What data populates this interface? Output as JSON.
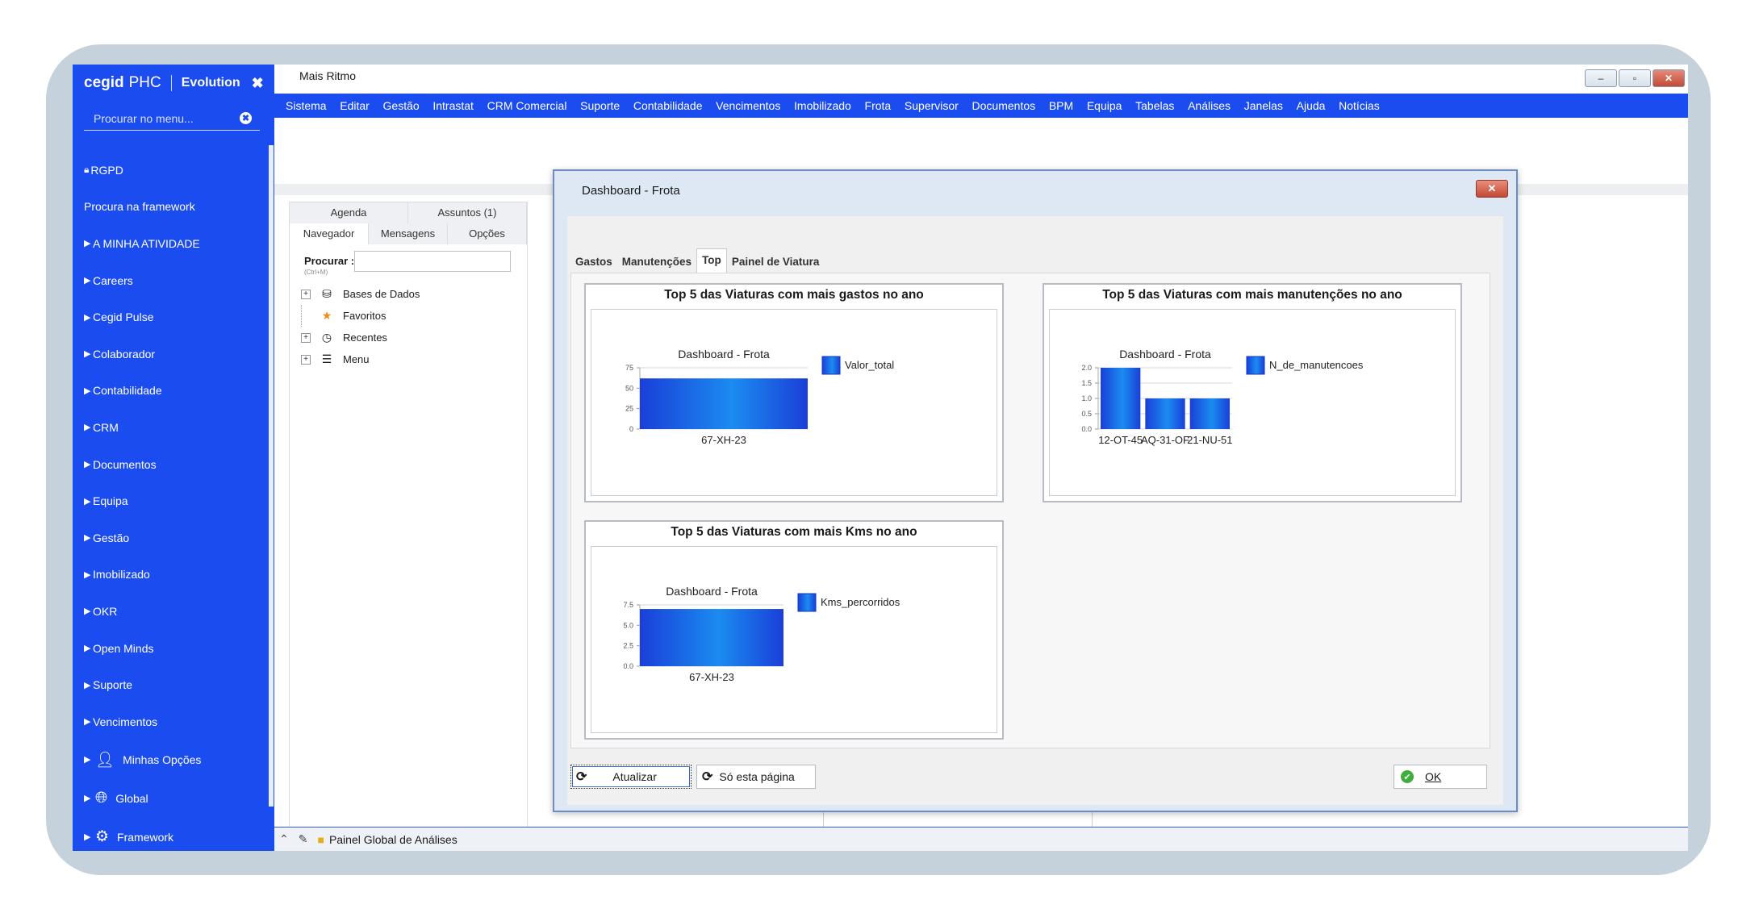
{
  "sidebar": {
    "brand": {
      "name": "cegid",
      "product": "PHC",
      "edition": "Evolution",
      "close_icon": "✖"
    },
    "search": {
      "placeholder": "Procurar no menu...",
      "clear_icon": "✖"
    },
    "items": [
      {
        "label": "RGPD",
        "icon": "lock-icon"
      },
      {
        "label": "Procura na framework"
      },
      {
        "label": "A MINHA ATIVIDADE"
      },
      {
        "label": "Careers"
      },
      {
        "label": "Cegid Pulse"
      },
      {
        "label": "Colaborador"
      },
      {
        "label": "Contabilidade"
      },
      {
        "label": "CRM"
      },
      {
        "label": "Documentos"
      },
      {
        "label": "Equipa"
      },
      {
        "label": "Gestão"
      },
      {
        "label": "Imobilizado"
      },
      {
        "label": "OKR"
      },
      {
        "label": "Open Minds"
      },
      {
        "label": "Suporte"
      },
      {
        "label": "Vencimentos"
      },
      {
        "label": "Minhas Opções",
        "icon": "user-icon"
      },
      {
        "label": "Global",
        "icon": "globe-icon"
      },
      {
        "label": "Framework",
        "icon": "gears-icon"
      }
    ]
  },
  "window": {
    "title": "Mais Ritmo",
    "controls": {
      "minimize": "–",
      "maximize": "▫",
      "close": "✕"
    },
    "menu": [
      "Sistema",
      "Editar",
      "Gestão",
      "Intrastat",
      "CRM Comercial",
      "Suporte",
      "Contabilidade",
      "Vencimentos",
      "Imobilizado",
      "Frota",
      "Supervisor",
      "Documentos",
      "BPM",
      "Equipa",
      "Tabelas",
      "Análises",
      "Janelas",
      "Ajuda",
      "Notícias"
    ]
  },
  "navigator": {
    "top_tabs": [
      "Agenda",
      "Assuntos (1)"
    ],
    "tabs": [
      "Navegador",
      "Mensagens",
      "Opções"
    ],
    "search_label": "Procurar :",
    "search_hint": "(Ctrl+M)",
    "tree": [
      {
        "label": "Bases de Dados",
        "icon": "database-icon",
        "expandable": true
      },
      {
        "label": "Favoritos",
        "icon": "star-icon",
        "expandable": false
      },
      {
        "label": "Recentes",
        "icon": "clock-icon",
        "expandable": true
      },
      {
        "label": "Menu",
        "icon": "menu-icon",
        "expandable": true
      }
    ]
  },
  "statusbar": {
    "label": "Painel Global de Análises"
  },
  "dialog": {
    "title": "Dashboard - Frota",
    "close": "✕",
    "tabs": [
      "Gastos",
      "Manutenções",
      "Top",
      "Painel de Viatura"
    ],
    "active_tab": "Top",
    "buttons": {
      "refresh": "Atualizar",
      "this_page": "Só esta página",
      "ok": "OK"
    }
  },
  "chart_data": [
    {
      "type": "bar",
      "panel_title": "Top 5 das Viaturas com mais gastos no ano",
      "title": "Dashboard - Frota",
      "categories": [
        "67-XH-23"
      ],
      "series": [
        {
          "name": "Valor_total",
          "values": [
            62
          ]
        }
      ],
      "yticks": [
        "75",
        "50",
        "25",
        "0"
      ],
      "ylim": [
        0,
        75
      ],
      "legend": "right",
      "color": "#1650e6"
    },
    {
      "type": "bar",
      "panel_title": "Top 5 das Viaturas com mais manutenções no ano",
      "title": "Dashboard - Frota",
      "categories": [
        "12-OT-45",
        "AQ-31-OF",
        "21-NU-51"
      ],
      "series": [
        {
          "name": "N_de_manutencoes",
          "values": [
            2,
            1,
            1
          ]
        }
      ],
      "yticks": [
        "2.0",
        "1.5",
        "1.0",
        "0.5",
        "0.0"
      ],
      "ylim": [
        0,
        2
      ],
      "legend": "right",
      "color": "#1650e6"
    },
    {
      "type": "bar",
      "panel_title": "Top 5 das Viaturas com mais Kms no ano",
      "title": "Dashboard - Frota",
      "categories": [
        "67-XH-23"
      ],
      "series": [
        {
          "name": "Kms_percorridos",
          "values": [
            7
          ]
        }
      ],
      "yticks": [
        "7.5",
        "5.0",
        "2.5",
        "0.0"
      ],
      "ylim": [
        0,
        7.5
      ],
      "legend": "right",
      "color": "#1650e6"
    }
  ]
}
